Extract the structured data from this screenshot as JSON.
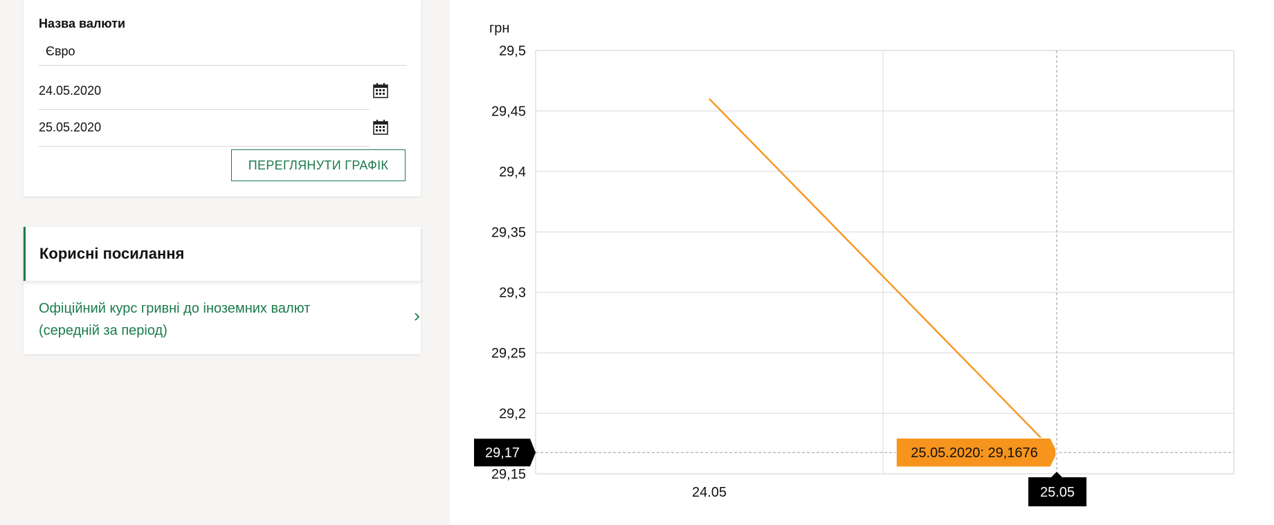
{
  "form": {
    "currency_label": "Назва валюти",
    "currency_value": "Євро",
    "date_from": "24.05.2020",
    "date_to": "25.05.2020",
    "view_button_label": "ПЕРЕГЛЯНУТИ ГРАФІК"
  },
  "links": {
    "title": "Корисні посилання",
    "items": [
      {
        "label": "Офіційний курс гривні до іноземних валют (середній за період)"
      }
    ]
  },
  "colors": {
    "brand_green": "#1b7b4b",
    "series_orange": "#f7941d",
    "tooltip_black": "#000000"
  },
  "icons": {
    "calendar": "calendar-icon",
    "chevron": "chevron-right-icon"
  },
  "chart_data": {
    "type": "line",
    "ylabel": "грн",
    "ylim": [
      29.15,
      29.5
    ],
    "y_ticks": [
      "29,5",
      "29,45",
      "29,4",
      "29,35",
      "29,3",
      "29,25",
      "29,2",
      "29,15"
    ],
    "y_tick_values": [
      29.5,
      29.45,
      29.4,
      29.35,
      29.3,
      29.25,
      29.2,
      29.15
    ],
    "categories": [
      "24.05",
      "25.05"
    ],
    "series": [
      {
        "values": [
          29.46,
          29.1676
        ]
      }
    ],
    "grid": true,
    "hover": {
      "y_readout": "29,17",
      "x_readout": "25.05",
      "tooltip": "25.05.2020: 29,1676"
    }
  }
}
